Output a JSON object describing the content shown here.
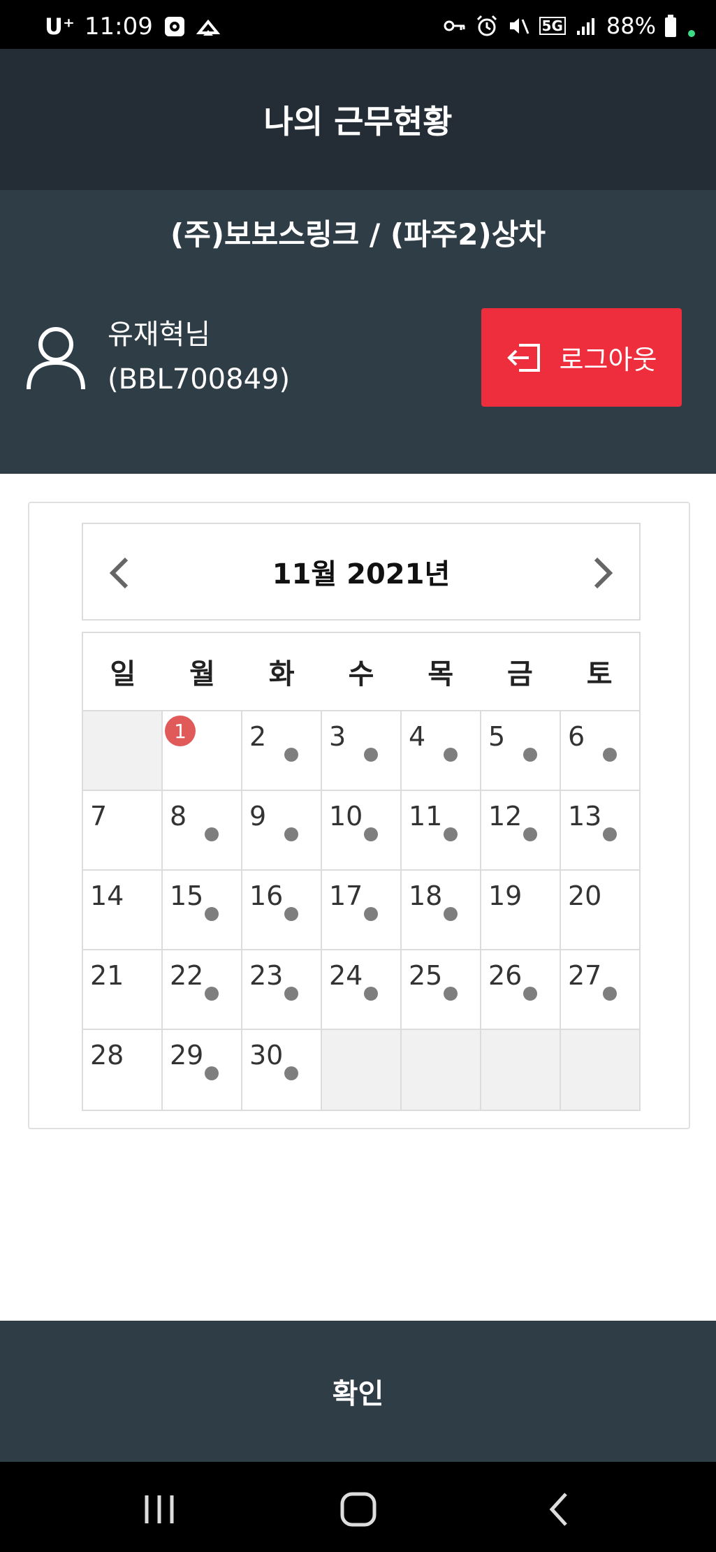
{
  "status_bar": {
    "carrier": "U⁺",
    "time": "11:09",
    "network": "5G",
    "battery": "88%",
    "icons": [
      "media-icon",
      "cast-icon",
      "key-icon",
      "alarm-icon",
      "mute-icon",
      "signal-icon",
      "battery-icon"
    ]
  },
  "header": {
    "title": "나의 근무현황"
  },
  "info": {
    "company": "(주)보보스링크 / (파주2)상차",
    "user_name": "유재혁님",
    "user_id": "(BBL700849)",
    "logout_label": "로그아웃"
  },
  "calendar": {
    "title": "11월 2021년",
    "weekdays": [
      "일",
      "월",
      "화",
      "수",
      "목",
      "금",
      "토"
    ],
    "weeks": [
      [
        {
          "d": ""
        },
        {
          "d": "1",
          "today": true
        },
        {
          "d": "2",
          "dot": true
        },
        {
          "d": "3",
          "dot": true
        },
        {
          "d": "4",
          "dot": true
        },
        {
          "d": "5",
          "dot": true
        },
        {
          "d": "6",
          "dot": true
        }
      ],
      [
        {
          "d": "7"
        },
        {
          "d": "8",
          "dot": true
        },
        {
          "d": "9",
          "dot": true
        },
        {
          "d": "10",
          "dot": true
        },
        {
          "d": "11",
          "dot": true
        },
        {
          "d": "12",
          "dot": true
        },
        {
          "d": "13",
          "dot": true
        }
      ],
      [
        {
          "d": "14"
        },
        {
          "d": "15",
          "dot": true
        },
        {
          "d": "16",
          "dot": true
        },
        {
          "d": "17",
          "dot": true
        },
        {
          "d": "18",
          "dot": true
        },
        {
          "d": "19"
        },
        {
          "d": "20"
        }
      ],
      [
        {
          "d": "21"
        },
        {
          "d": "22",
          "dot": true
        },
        {
          "d": "23",
          "dot": true
        },
        {
          "d": "24",
          "dot": true
        },
        {
          "d": "25",
          "dot": true
        },
        {
          "d": "26",
          "dot": true
        },
        {
          "d": "27",
          "dot": true
        }
      ],
      [
        {
          "d": "28"
        },
        {
          "d": "29",
          "dot": true
        },
        {
          "d": "30",
          "dot": true
        },
        {
          "d": ""
        },
        {
          "d": ""
        },
        {
          "d": ""
        },
        {
          "d": ""
        }
      ]
    ]
  },
  "footer": {
    "confirm_label": "확인"
  },
  "nav_bar": {
    "icons": [
      "recent-apps-icon",
      "home-icon",
      "back-icon"
    ]
  },
  "colors": {
    "title_bar": "#242d35",
    "panel": "#2f3d47",
    "logout": "#ee2d3d",
    "today_badge": "#e15a5a",
    "dot": "#7e7e7e"
  }
}
